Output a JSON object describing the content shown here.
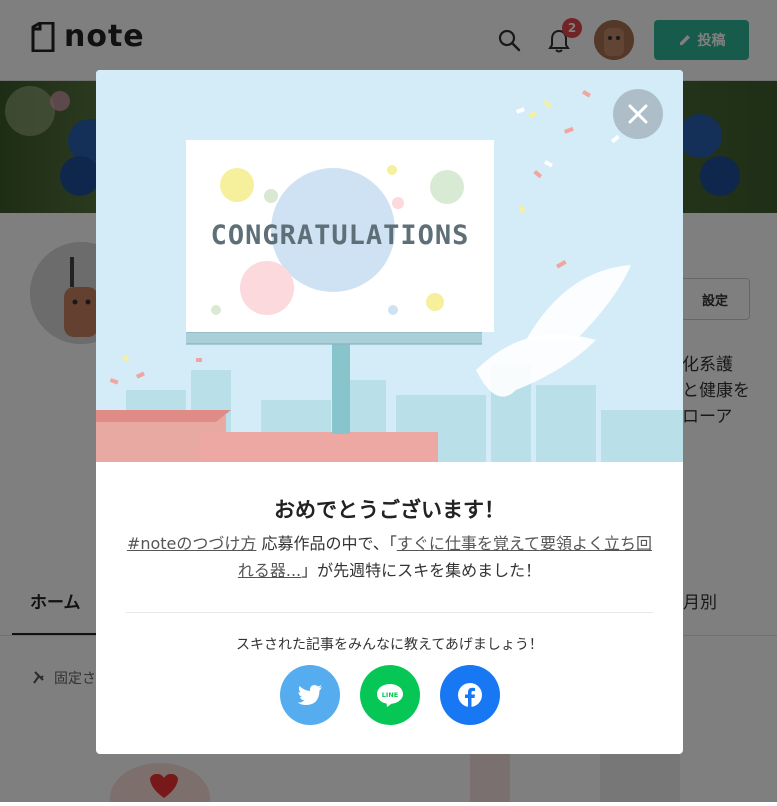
{
  "header": {
    "logo_text": "note",
    "notification_count": "2",
    "post_button_label": "投稿"
  },
  "profile": {
    "settings_label": "設定",
    "bio_lines": [
      "化系護",
      "と健康を",
      "ローア"
    ]
  },
  "tabs": {
    "home": "ホーム",
    "monthly": "月別"
  },
  "pinned_label": "固定さ",
  "modal": {
    "billboard_text": "CONGRATULATIONS",
    "title": "おめでとうございます！",
    "message_link_1": "#noteのつづけ方",
    "message_part_1": " 応募作品の中で、「",
    "message_link_2": "すぐに仕事を覚えて要領よく立ち回れる器...",
    "message_part_2": "」が先週特にスキを集めました！",
    "share_prompt": "スキされた記事をみんなに教えてあげましょう！",
    "share_buttons": [
      "twitter",
      "line",
      "facebook"
    ]
  },
  "colors": {
    "brand_green": "#2cb696",
    "twitter_blue": "#55acee",
    "line_green": "#06c755",
    "facebook_blue": "#1877f2",
    "badge_red": "#e2474a"
  }
}
